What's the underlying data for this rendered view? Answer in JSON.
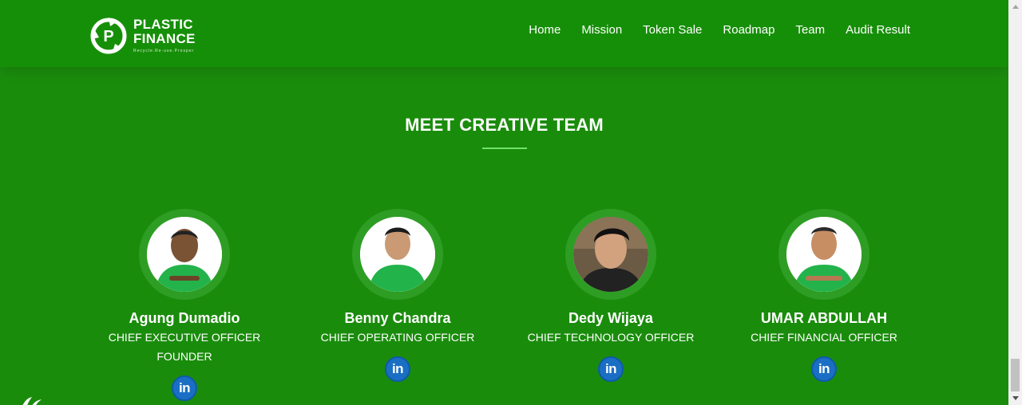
{
  "brand": {
    "line1": "PLASTIC",
    "line2": "FINANCE",
    "tagline": "Recycle.Re-use.Prosper"
  },
  "nav": {
    "items": [
      {
        "label": "Home"
      },
      {
        "label": "Mission"
      },
      {
        "label": "Token Sale"
      },
      {
        "label": "Roadmap"
      },
      {
        "label": "Team"
      },
      {
        "label": "Audit Result"
      }
    ]
  },
  "section": {
    "title": "MEET CREATIVE TEAM"
  },
  "team": [
    {
      "name": "Agung Dumadio",
      "role": "CHIEF EXECUTIVE OFFICER",
      "role2": "FOUNDER",
      "social": "in",
      "shirt": "green"
    },
    {
      "name": "Benny Chandra",
      "role": "CHIEF OPERATING OFFICER",
      "role2": "",
      "social": "in",
      "shirt": "green"
    },
    {
      "name": "Dedy Wijaya",
      "role": "CHIEF TECHNOLOGY OFFICER",
      "role2": "",
      "social": "in",
      "shirt": "dark"
    },
    {
      "name": "UMAR ABDULLAH",
      "role": "CHIEF FINANCIAL OFFICER",
      "role2": "",
      "social": "in",
      "shirt": "green"
    }
  ],
  "colors": {
    "background": "#1a8c0c",
    "accent": "#6fe36a",
    "linkedin": "#1a6fc4"
  }
}
